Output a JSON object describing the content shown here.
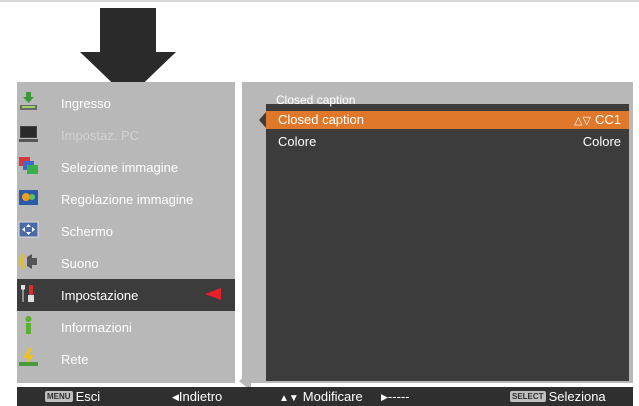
{
  "menu": {
    "items": [
      {
        "label": "Ingresso",
        "icon": "input-icon",
        "state": "normal"
      },
      {
        "label": "Impostaz. PC",
        "icon": "pc-icon",
        "state": "disabled"
      },
      {
        "label": "Selezione immagine",
        "icon": "image-select-icon",
        "state": "normal"
      },
      {
        "label": "Regolazione immagine",
        "icon": "image-adjust-icon",
        "state": "normal"
      },
      {
        "label": "Schermo",
        "icon": "screen-icon",
        "state": "normal"
      },
      {
        "label": "Suono",
        "icon": "sound-icon",
        "state": "normal"
      },
      {
        "label": "Impostazione",
        "icon": "settings-icon",
        "state": "selected"
      },
      {
        "label": "Informazioni",
        "icon": "info-icon",
        "state": "normal"
      },
      {
        "label": "Rete",
        "icon": "network-icon",
        "state": "normal"
      }
    ]
  },
  "submenu": {
    "title": "Closed caption",
    "rows": [
      {
        "name": "Closed caption",
        "value": "CC1",
        "selected": true
      },
      {
        "name": "Colore",
        "value": "Colore",
        "selected": false
      }
    ]
  },
  "footer": {
    "esc_key": "MENU",
    "esc_label": "Esci",
    "back_label": "Indietro",
    "modify_label": "Modificare",
    "next_label": "-----",
    "select_key": "SELECT",
    "select_label": "Seleziona"
  },
  "colors": {
    "panel": "#b8b8b8",
    "panel_dark": "#3c3c3c",
    "highlight": "#e0782b",
    "marker": "#e8202a"
  }
}
